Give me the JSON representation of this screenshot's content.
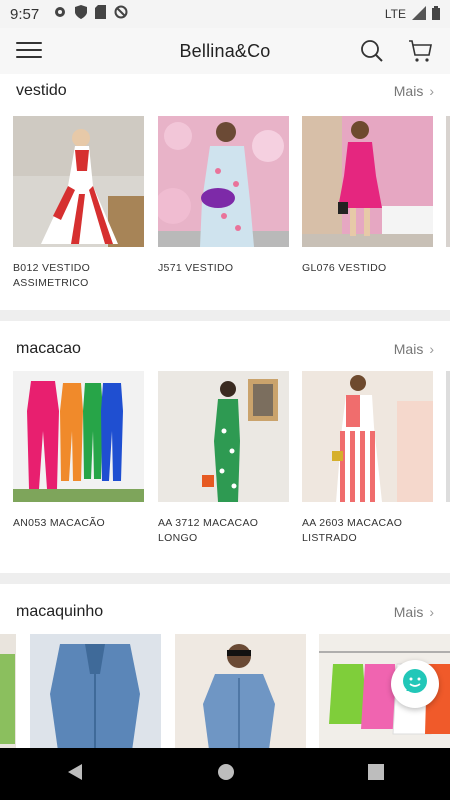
{
  "status_bar": {
    "time": "9:57",
    "network": "LTE"
  },
  "header": {
    "title": "Bellina&Co"
  },
  "sections": [
    {
      "title": "vestido",
      "more_label": "Mais",
      "products": [
        {
          "name": "B012 VESTIDO ASSIMETRICO"
        },
        {
          "name": "J571 VESTIDO"
        },
        {
          "name": "GL076 VESTIDO"
        }
      ]
    },
    {
      "title": "macacao",
      "more_label": "Mais",
      "products": [
        {
          "name": "AN053 MACACÃO"
        },
        {
          "name": "AA 3712 MACACAO LONGO"
        },
        {
          "name": "AA 2603 MACACAO LISTRADO"
        }
      ]
    },
    {
      "title": "macaquinho",
      "more_label": "Mais",
      "products": [
        {
          "name": ""
        },
        {
          "name": ""
        },
        {
          "name": ""
        }
      ]
    }
  ],
  "colors": {
    "chat_accent": "#22c7b8",
    "nav_bg": "#000000"
  }
}
